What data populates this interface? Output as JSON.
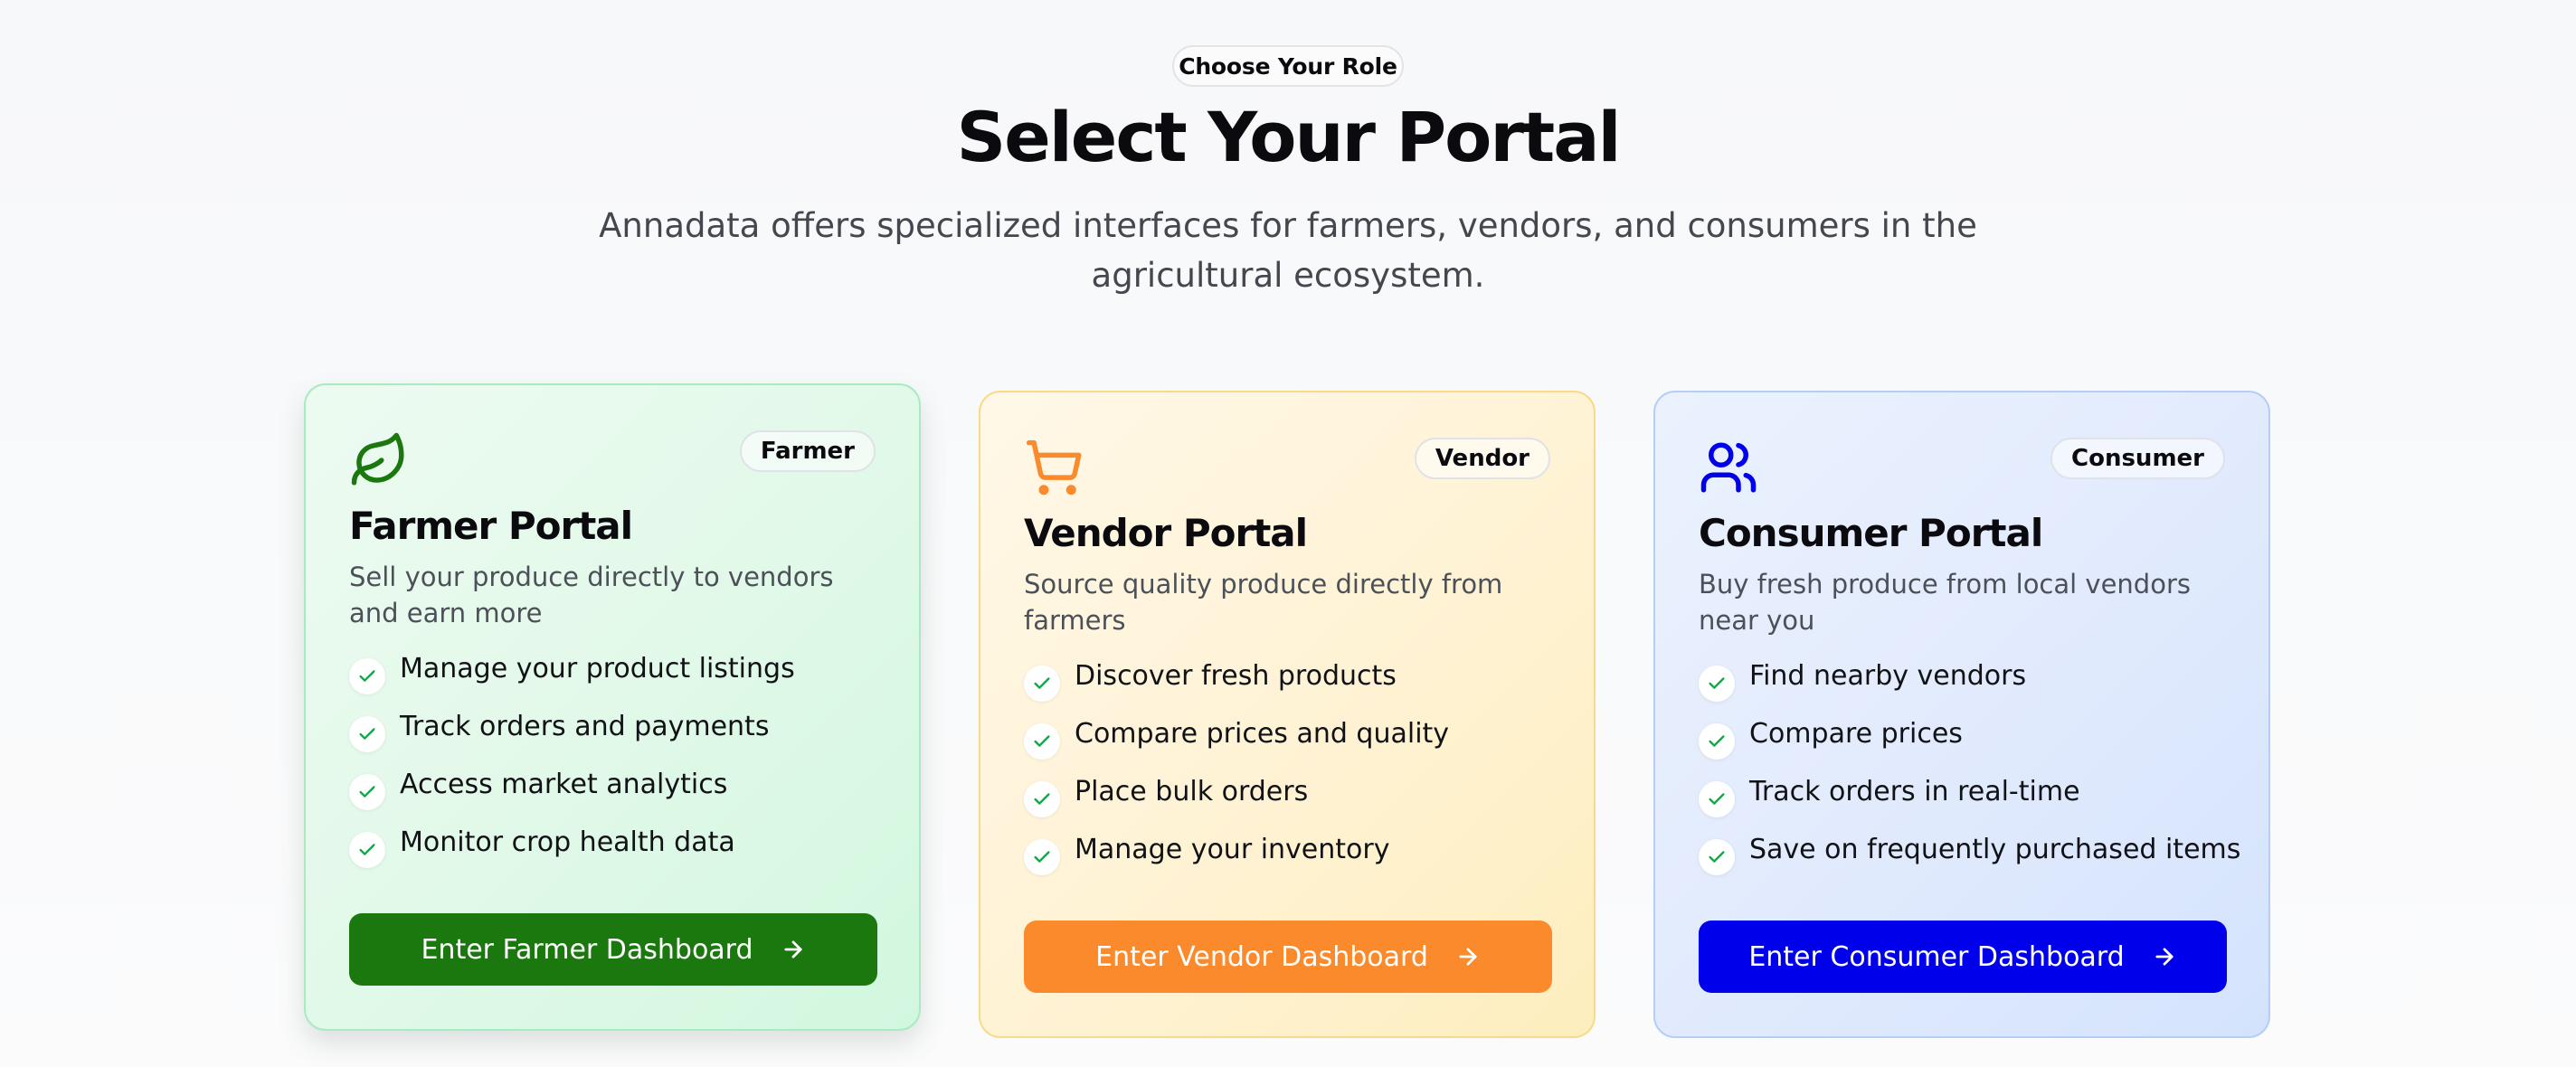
{
  "header": {
    "pill_label": "Choose Your Role",
    "title": "Select Your Portal",
    "subtitle": "Annadata offers specialized interfaces for farmers, vendors, and consumers in the agricultural ecosystem."
  },
  "colors": {
    "farmer_accent": "#1a780f",
    "vendor_accent": "#fb8a2c",
    "consumer_accent": "#0000ea",
    "check_color": "#16a34a"
  },
  "cards": [
    {
      "icon": "leaf-icon",
      "badge": "Farmer",
      "title": "Farmer Portal",
      "description": "Sell your produce directly to vendors and earn more",
      "features": [
        "Manage your product listings",
        "Track orders and payments",
        "Access market analytics",
        "Monitor crop health data"
      ],
      "button_label": "Enter Farmer Dashboard"
    },
    {
      "icon": "shopping-cart-icon",
      "badge": "Vendor",
      "title": "Vendor Portal",
      "description": "Source quality produce directly from farmers",
      "features": [
        "Discover fresh products",
        "Compare prices and quality",
        "Place bulk orders",
        "Manage your inventory"
      ],
      "button_label": "Enter Vendor Dashboard"
    },
    {
      "icon": "users-icon",
      "badge": "Consumer",
      "title": "Consumer Portal",
      "description": "Buy fresh produce from local vendors near you",
      "features": [
        "Find nearby vendors",
        "Compare prices",
        "Track orders in real-time",
        "Save on frequently purchased items"
      ],
      "button_label": "Enter Consumer Dashboard"
    }
  ]
}
